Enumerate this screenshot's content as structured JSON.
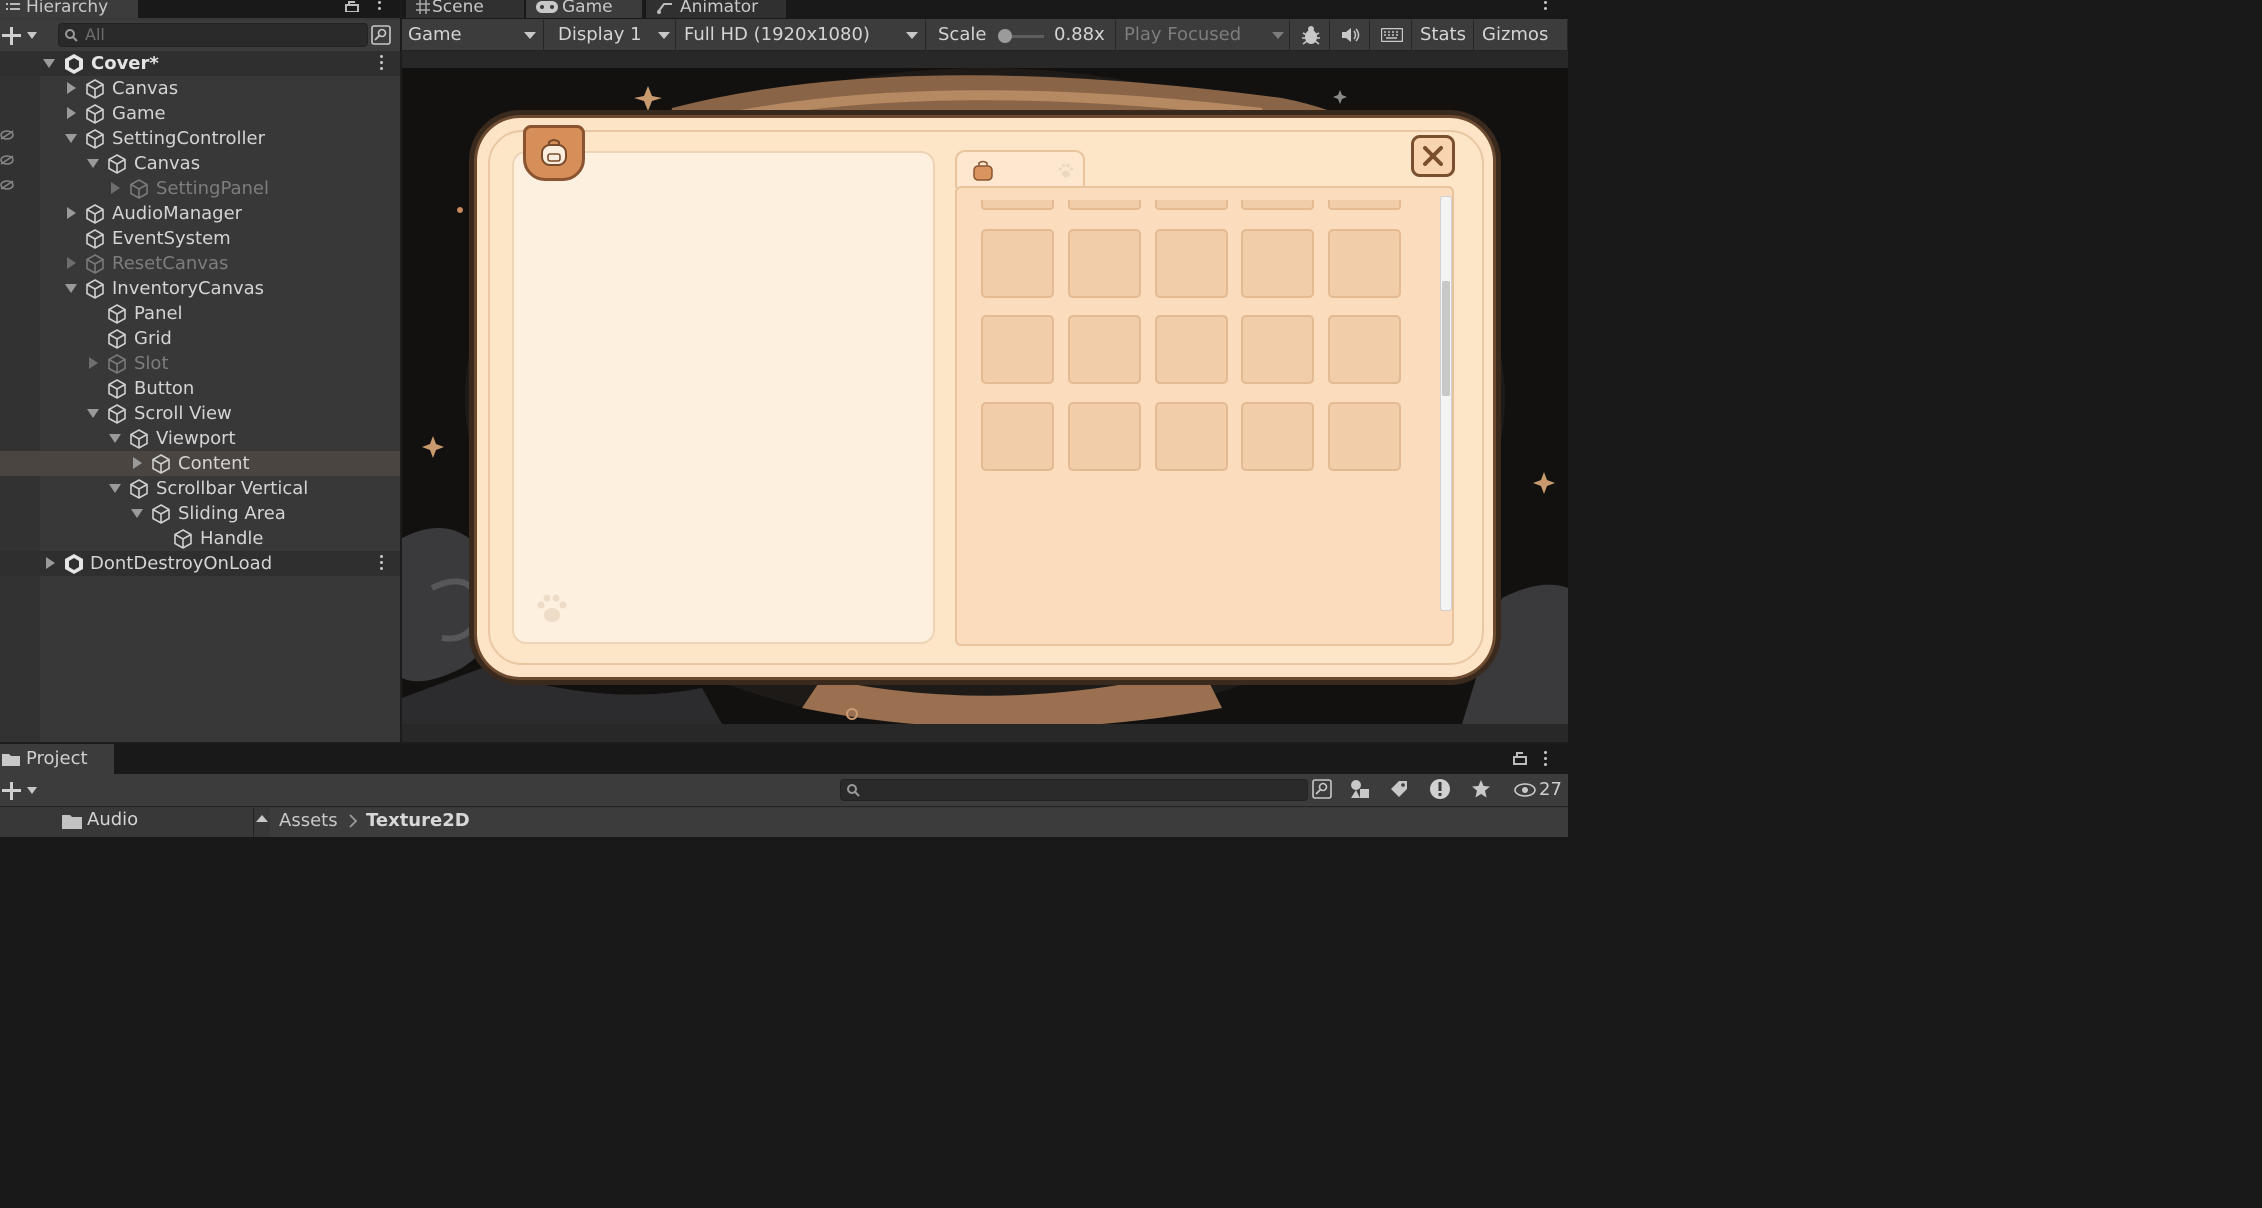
{
  "hierarchy": {
    "tab_label": "Hierarchy",
    "search_placeholder": "All",
    "rows": [
      {
        "label": "Cover*"
      },
      {
        "label": "Canvas"
      },
      {
        "label": "Game"
      },
      {
        "label": "SettingController"
      },
      {
        "label": "Canvas"
      },
      {
        "label": "SettingPanel"
      },
      {
        "label": "AudioManager"
      },
      {
        "label": "EventSystem"
      },
      {
        "label": "ResetCanvas"
      },
      {
        "label": "InventoryCanvas"
      },
      {
        "label": "Panel"
      },
      {
        "label": "Grid"
      },
      {
        "label": "Slot"
      },
      {
        "label": "Button"
      },
      {
        "label": "Scroll View"
      },
      {
        "label": "Viewport"
      },
      {
        "label": "Content"
      },
      {
        "label": "Scrollbar Vertical"
      },
      {
        "label": "Sliding Area"
      },
      {
        "label": "Handle"
      },
      {
        "label": "DontDestroyOnLoad"
      }
    ]
  },
  "game_tabs": {
    "scene": "Scene",
    "game": "Game",
    "animator": "Animator"
  },
  "game_toolbar": {
    "view_select": "Game",
    "display_select": "Display 1",
    "resolution_select": "Full HD (1920x1080)",
    "scale_label": "Scale",
    "scale_value": "0.88x",
    "play_mode_select": "Play Focused",
    "stats_label": "Stats",
    "gizmos_label": "Gizmos"
  },
  "project": {
    "tab_label": "Project",
    "hidden_count": "27",
    "folder_item": "Audio",
    "breadcrumb_root": "Assets",
    "breadcrumb_current": "Texture2D"
  },
  "colors": {
    "accent_orange": "#d68f58",
    "panel_cream": "#fde4c6",
    "editor_bg": "#383838"
  }
}
